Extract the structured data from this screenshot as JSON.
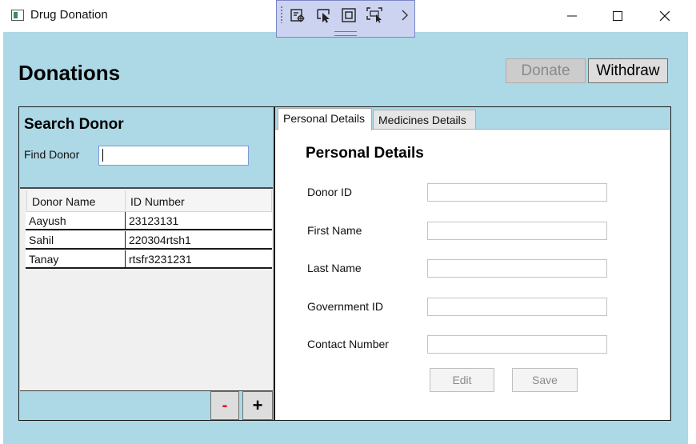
{
  "window": {
    "title": "Drug Donation",
    "minimize_icon": "minimize-icon",
    "maximize_icon": "maximize-icon",
    "close_icon": "close-icon"
  },
  "debug_toolbar": {
    "buttons": [
      "live-visual-tree-icon",
      "select-element-icon",
      "display-layout-adorners-icon",
      "track-focused-element-icon",
      "chevron-right-icon"
    ]
  },
  "header": {
    "title": "Donations",
    "donate_label": "Donate",
    "withdraw_label": "Withdraw"
  },
  "search": {
    "title": "Search Donor",
    "find_label": "Find Donor",
    "find_value": ""
  },
  "donor_grid": {
    "columns": [
      "Donor Name",
      "ID Number"
    ],
    "rows": [
      [
        "Aayush",
        "23123131"
      ],
      [
        "Sahil",
        "220304rtsh1"
      ],
      [
        "Tanay",
        "rtsfr3231231"
      ]
    ],
    "remove_label": "-",
    "add_label": "+"
  },
  "tabs": {
    "items": [
      "Personal Details",
      "Medicines Details"
    ],
    "selected": "Personal Details"
  },
  "personal_details": {
    "title": "Personal Details",
    "fields": [
      {
        "label": "Donor ID",
        "value": ""
      },
      {
        "label": "First Name",
        "value": ""
      },
      {
        "label": "Last Name",
        "value": ""
      },
      {
        "label": "Government ID",
        "value": ""
      },
      {
        "label": "Contact Number",
        "value": ""
      }
    ],
    "edit_label": "Edit",
    "save_label": "Save"
  },
  "colors": {
    "client_background": "#add8e6",
    "toolbar_background": "#ccd3f0",
    "remove_button_text": "#e00000"
  }
}
